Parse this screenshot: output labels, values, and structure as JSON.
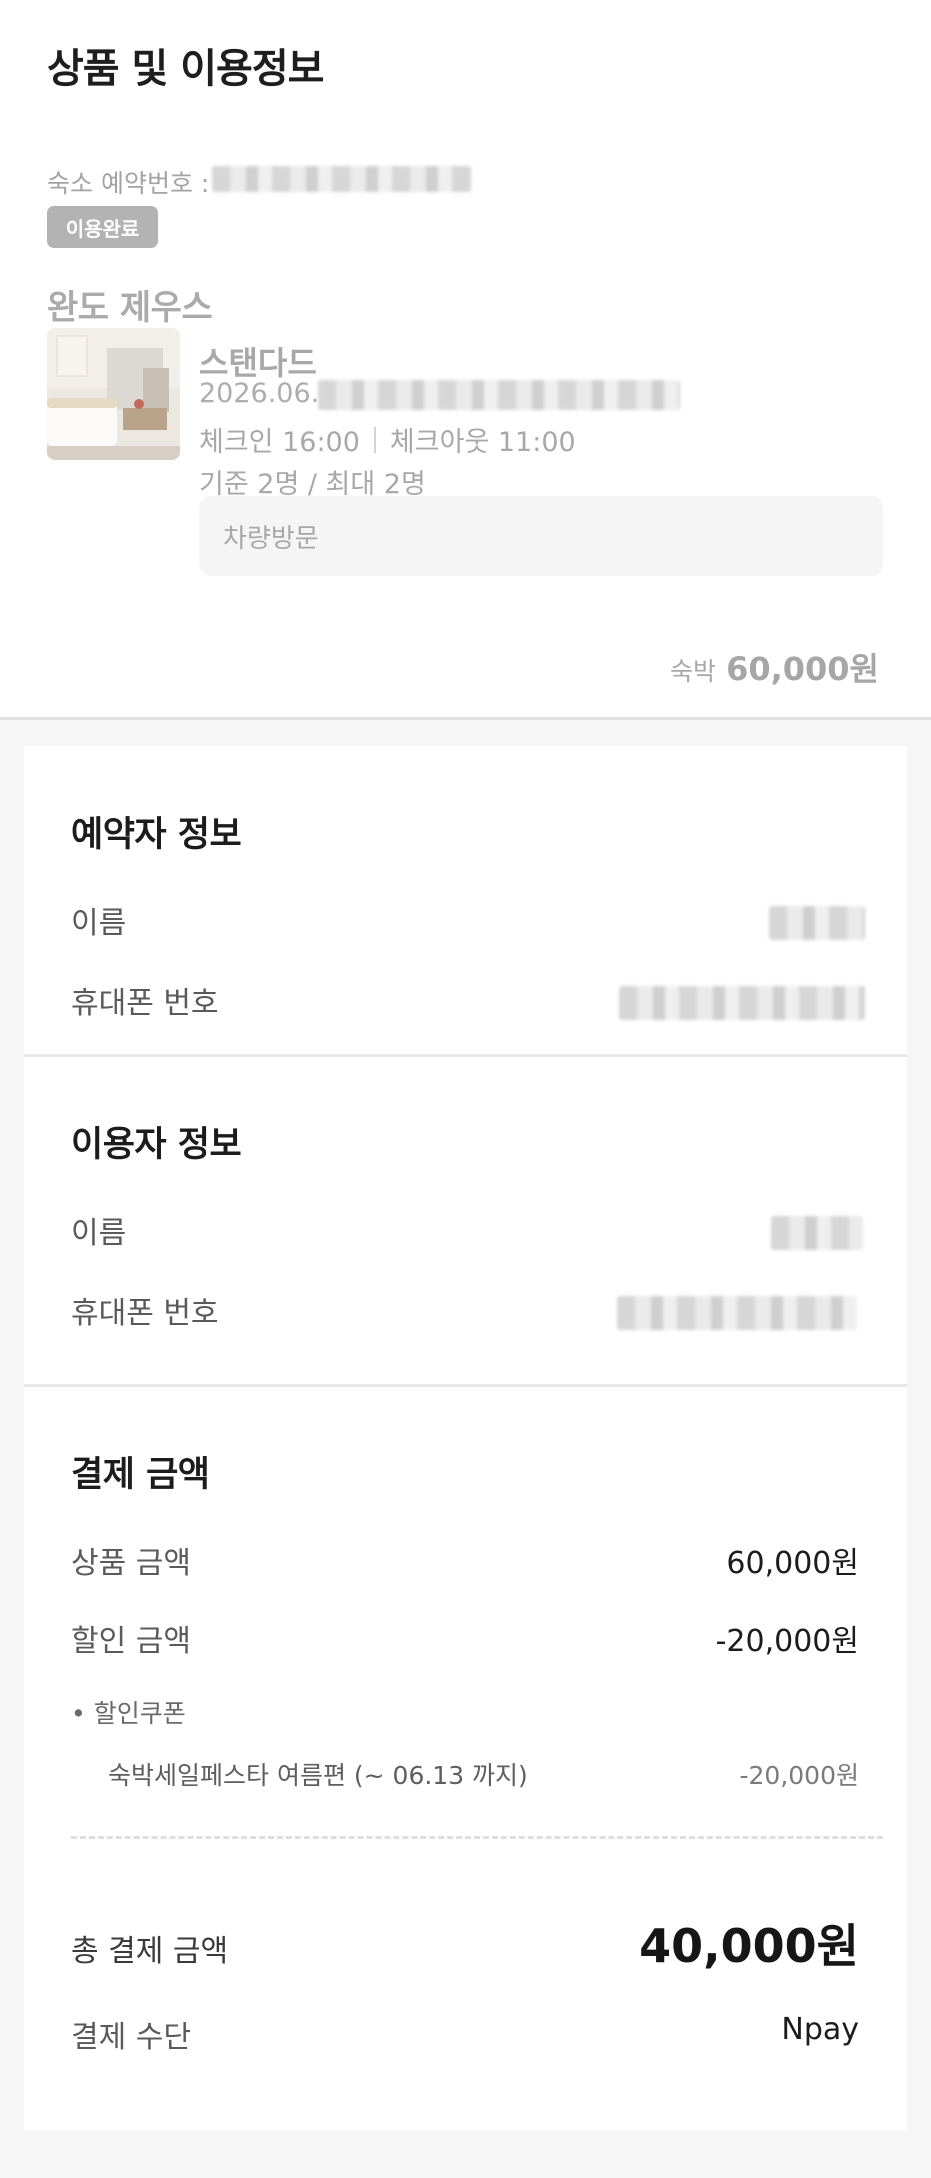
{
  "page_title": "상품 및 이용정보",
  "reservation": {
    "number_label": "숙소 예약번호 :",
    "status_badge": "이용완료",
    "hotel_name": "완도 제우스",
    "room_name": "스탠다드",
    "date_prefix": "2026.06.",
    "checkin": "체크인 16:00",
    "checkout": "체크아웃 11:00",
    "capacity": "기준 2명 / 최대 2명",
    "visit_method": "차량방문",
    "price_label": "숙박",
    "price_value": "60,000원"
  },
  "booker_info": {
    "title": "예약자 정보",
    "name_label": "이름",
    "phone_label": "휴대폰 번호"
  },
  "user_info": {
    "title": "이용자 정보",
    "name_label": "이름",
    "phone_label": "휴대폰 번호"
  },
  "payment": {
    "title": "결제 금액",
    "product_label": "상품 금액",
    "product_value": "60,000원",
    "discount_label": "할인 금액",
    "discount_value": "-20,000원",
    "coupon_header": "• 할인쿠폰",
    "coupon_name": "숙박세일페스타 여름편 (~ 06.13 까지)",
    "coupon_value": "-20,000원",
    "total_label": "총 결제 금액",
    "total_value": "40,000원",
    "method_label": "결제 수단",
    "method_value": "Npay"
  }
}
